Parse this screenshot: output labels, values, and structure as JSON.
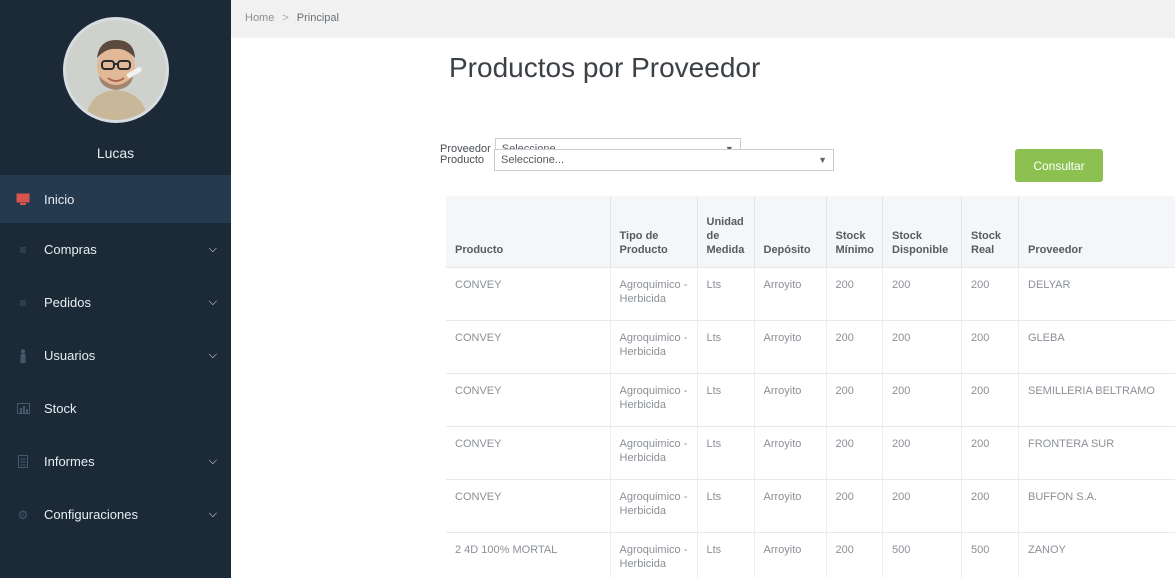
{
  "user": {
    "name": "Lucas"
  },
  "nav": [
    {
      "label": "Inicio",
      "icon": "monitor-icon",
      "active": true,
      "chevron": false
    },
    {
      "label": "Compras",
      "icon": "list-icon",
      "active": false,
      "chevron": true
    },
    {
      "label": "Pedidos",
      "icon": "list-icon",
      "active": false,
      "chevron": true
    },
    {
      "label": "Usuarios",
      "icon": "user-icon",
      "active": false,
      "chevron": true
    },
    {
      "label": "Stock",
      "icon": "bar-chart-icon",
      "active": false,
      "chevron": false
    },
    {
      "label": "Informes",
      "icon": "document-icon",
      "active": false,
      "chevron": true
    },
    {
      "label": "Configuraciones",
      "icon": "gear-icon",
      "active": false,
      "chevron": true
    }
  ],
  "breadcrumb": {
    "home": "Home",
    "separator": ">",
    "current": "Principal"
  },
  "page": {
    "title": "Productos por Proveedor"
  },
  "form": {
    "proveedor_label": "Proveedor",
    "proveedor_value": "Seleccione...",
    "producto_label": "Producto",
    "producto_value": "Seleccione...",
    "submit_label": "Consultar"
  },
  "table": {
    "headers": [
      "Producto",
      "Tipo de Producto",
      "Unidad de Medida",
      "Depósito",
      "Stock Mínimo",
      "Stock Disponible",
      "Stock Real",
      "Proveedor"
    ],
    "rows": [
      [
        "CONVEY",
        "Agroquimico - Herbicida",
        "Lts",
        "Arroyito",
        "200",
        "200",
        "200",
        "DELYAR"
      ],
      [
        "CONVEY",
        "Agroquimico - Herbicida",
        "Lts",
        "Arroyito",
        "200",
        "200",
        "200",
        "GLEBA"
      ],
      [
        "CONVEY",
        "Agroquimico - Herbicida",
        "Lts",
        "Arroyito",
        "200",
        "200",
        "200",
        "SEMILLERIA BELTRAMO"
      ],
      [
        "CONVEY",
        "Agroquimico - Herbicida",
        "Lts",
        "Arroyito",
        "200",
        "200",
        "200",
        "FRONTERA SUR"
      ],
      [
        "CONVEY",
        "Agroquimico - Herbicida",
        "Lts",
        "Arroyito",
        "200",
        "200",
        "200",
        "BUFFON S.A."
      ],
      [
        "2 4D 100% MORTAL",
        "Agroquimico - Herbicida",
        "Lts",
        "Arroyito",
        "200",
        "500",
        "500",
        "ZANOY"
      ]
    ]
  },
  "colors": {
    "sidebar": "#1c2a38",
    "sidebar_active": "#263a4f",
    "accent_red": "#d9534f",
    "button_green": "#8cc152"
  }
}
